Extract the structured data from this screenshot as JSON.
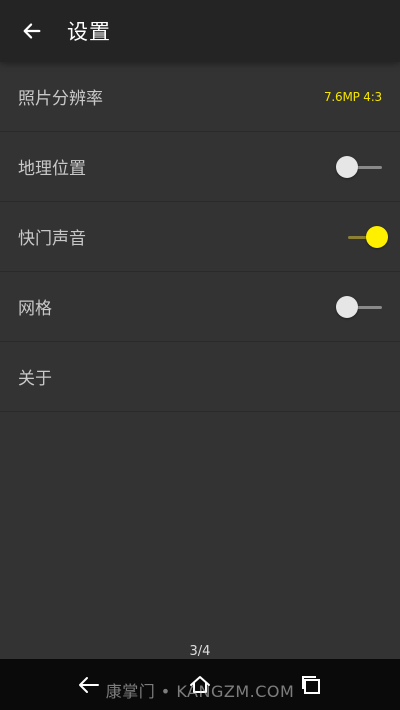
{
  "header": {
    "title": "设置",
    "back_icon": "arrow-left-icon"
  },
  "settings": [
    {
      "label": "照片分辨率",
      "value": "7.6MP 4:3"
    },
    {
      "label": "地理位置",
      "toggle": false
    },
    {
      "label": "快门声音",
      "toggle": true
    },
    {
      "label": "网格",
      "toggle": false
    },
    {
      "label": "关于"
    }
  ],
  "page_indicator": "3/4",
  "navbar": {
    "back_icon": "nav-back-icon",
    "home_icon": "nav-home-icon",
    "recent_icon": "nav-recent-apps-icon"
  },
  "watermark": "康掌门 • KANGZM.COM",
  "colors": {
    "accent": "#fff000",
    "background": "#333333",
    "app_bar": "#242424",
    "nav_bar": "#0a0a0a"
  }
}
